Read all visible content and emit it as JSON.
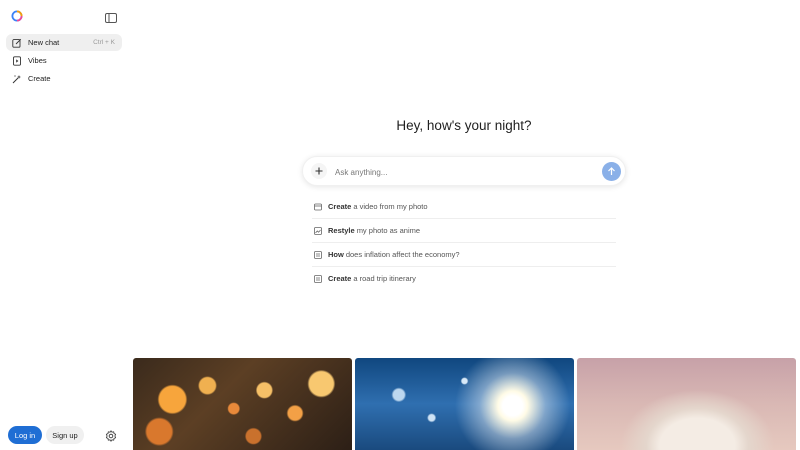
{
  "sidebar": {
    "logo_icon": "grok-logo-icon",
    "toggle_icon": "sidebar-toggle-icon",
    "items": [
      {
        "label": "New chat",
        "shortcut": "Ctrl + K",
        "icon": "edit-icon"
      },
      {
        "label": "Vibes",
        "shortcut": "",
        "icon": "video-icon"
      },
      {
        "label": "Create",
        "shortcut": "",
        "icon": "sparkle-icon"
      }
    ],
    "login_label": "Log in",
    "signup_label": "Sign up",
    "settings_icon": "gear-icon"
  },
  "main": {
    "greeting": "Hey, how's your night?",
    "input": {
      "placeholder": "Ask anything...",
      "value": ""
    },
    "suggestions": [
      {
        "bold": "Create",
        "rest": "a video from my photo",
        "icon": "video-card-icon"
      },
      {
        "bold": "Restyle",
        "rest": "my photo as anime",
        "icon": "image-icon"
      },
      {
        "bold": "How",
        "rest": "does inflation affect the economy?",
        "icon": "document-icon"
      },
      {
        "bold": "Create",
        "rest": "a road trip itinerary",
        "icon": "document-icon"
      }
    ],
    "images": [
      {
        "name": "bokeh-lights-image"
      },
      {
        "name": "sunlight-water-image"
      },
      {
        "name": "pastel-animal-image"
      }
    ]
  },
  "colors": {
    "accent": "#1f6ed4",
    "send_button": "#8ab0e8"
  }
}
